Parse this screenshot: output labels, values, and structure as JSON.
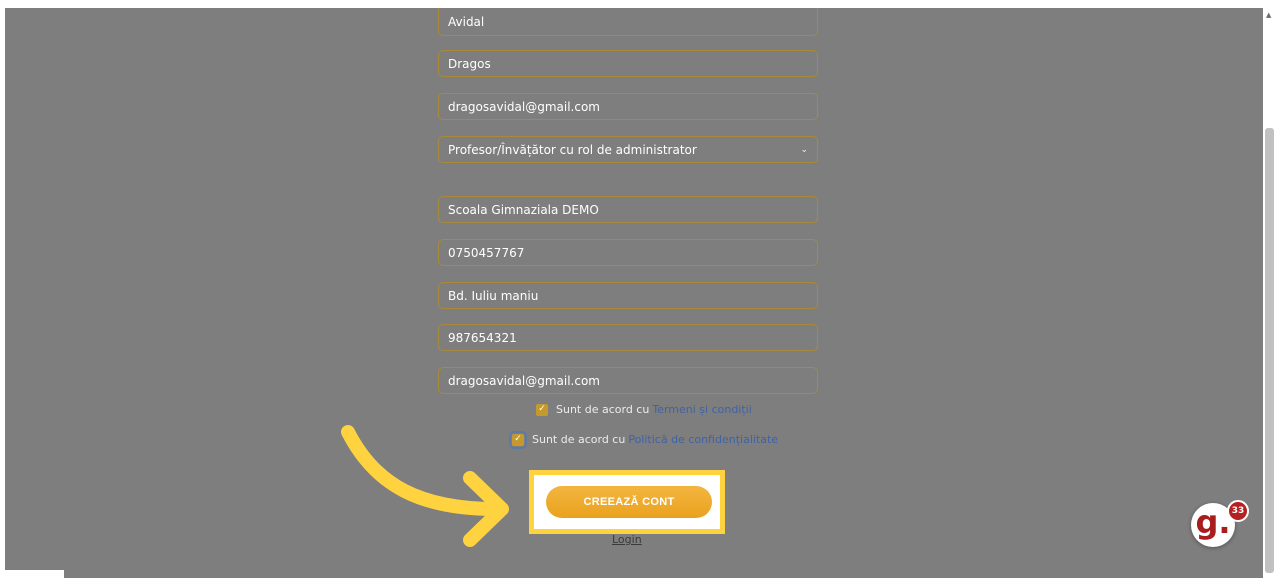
{
  "form": {
    "fields": [
      {
        "value": "Avidal"
      },
      {
        "value": "Dragos"
      },
      {
        "value": "dragosavidal@gmail.com"
      },
      {
        "value": "Profesor/Învățător cu rol de administrator",
        "type": "select"
      },
      {
        "value": "Scoala Gimnaziala DEMO"
      },
      {
        "value": "0750457767"
      },
      {
        "value": "Bd. Iuliu maniu"
      },
      {
        "value": "987654321"
      },
      {
        "value": "dragosavidal@gmail.com"
      }
    ],
    "terms": {
      "text": "Sunt de acord cu",
      "link": "Termeni și condiții",
      "checked": true
    },
    "privacy": {
      "text": "Sunt de acord cu",
      "link": "Politică de confidențialitate",
      "checked": true
    },
    "submit_label": "CREEAZĂ CONT",
    "login_label": "Login"
  },
  "chat": {
    "badge": "33",
    "logo": "g."
  },
  "colors": {
    "accent": "#eaa21e",
    "highlight": "#ffd23f",
    "overlay": "#7e7e7e",
    "link": "#3f62a8",
    "badge": "#b52020"
  },
  "icons": {
    "arrow": "curved-arrow-icon",
    "chevron": "chevron-down-icon",
    "check": "checkmark-icon"
  }
}
